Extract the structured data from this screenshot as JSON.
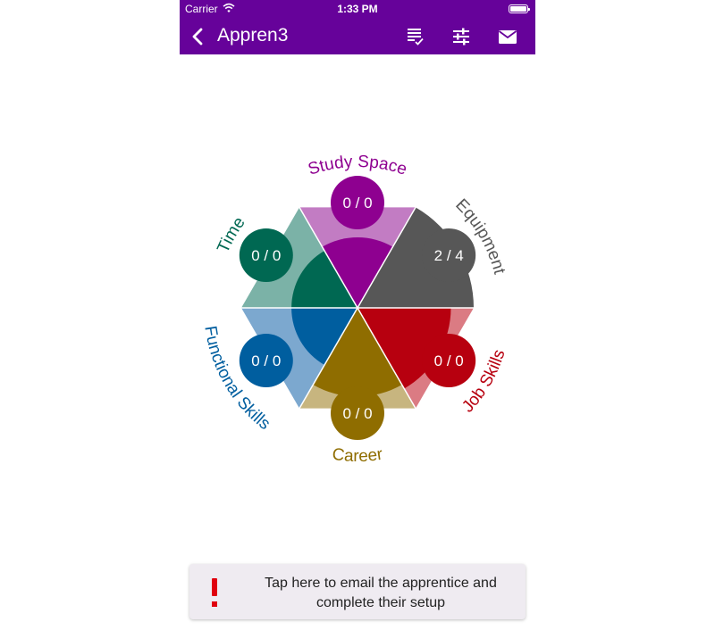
{
  "status_bar": {
    "carrier": "Carrier",
    "time": "1:33 PM"
  },
  "nav_bar": {
    "title": "Appren3",
    "color": "#66029a",
    "icons": [
      "chevron-left-icon",
      "checklist-icon",
      "sliders-icon",
      "mail-icon"
    ]
  },
  "wheel": {
    "segments": [
      {
        "label": "Study Space",
        "score": "0 / 0",
        "fraction": 0.5,
        "color": "#8e0090",
        "light": "#c27cc3"
      },
      {
        "label": "Equipment",
        "score": "2 / 4",
        "fraction": 1.0,
        "color": "#575757",
        "light": "#a9a9a9"
      },
      {
        "label": "Job Skills",
        "score": "0 / 0",
        "fraction": 0.75,
        "color": "#b7000f",
        "light": "#db7b83"
      },
      {
        "label": "Career",
        "score": "0 / 0",
        "fraction": 0.7,
        "color": "#8f6d00",
        "light": "#c7b57f"
      },
      {
        "label": "Functional Skills",
        "score": "0 / 0",
        "fraction": 0.45,
        "color": "#005e9f",
        "light": "#7ca8cf"
      },
      {
        "label": "Time",
        "score": "0 / 0",
        "fraction": 0.45,
        "color": "#006852",
        "light": "#7bb2a7"
      }
    ]
  },
  "banner": {
    "icon": "exclamation-icon",
    "icon_color": "#e0000e",
    "text": "Tap here to email the apprentice and complete their setup"
  }
}
